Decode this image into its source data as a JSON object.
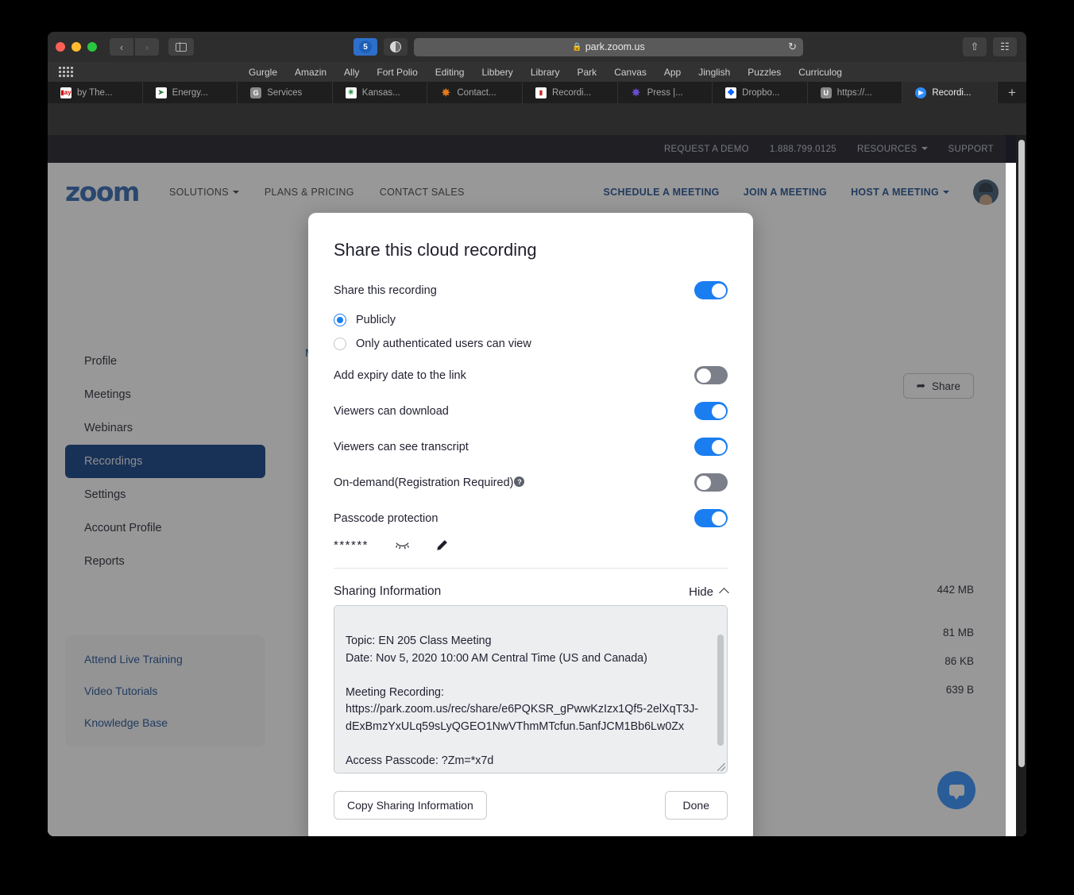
{
  "browser": {
    "address": "park.zoom.us",
    "lock_icon": "lock-icon",
    "reload_icon": "reload-icon",
    "extension_badge": "5",
    "favorites": [
      "Gurgle",
      "Amazin",
      "Ally",
      "Fort Polio",
      "Editing",
      "Libbery",
      "Library",
      "Park",
      "Canvas",
      "App",
      "Jinglish",
      "Puzzles",
      "Curriculog"
    ],
    "tabs": [
      {
        "title": "by The...",
        "favicon": "book-icon",
        "active": false
      },
      {
        "title": "Energy...",
        "favicon": "energy-icon",
        "active": false
      },
      {
        "title": "Services",
        "favicon": "g-icon",
        "active": false
      },
      {
        "title": "Kansas...",
        "favicon": "kansas-icon",
        "active": false
      },
      {
        "title": "Contact...",
        "favicon": "firefox-icon",
        "active": false
      },
      {
        "title": "Recordi...",
        "favicon": "recording-icon",
        "active": false
      },
      {
        "title": "Press |...",
        "favicon": "wordpress-icon",
        "active": false
      },
      {
        "title": "Dropbo...",
        "favicon": "dropbox-icon",
        "active": false
      },
      {
        "title": "https://...",
        "favicon": "u-icon",
        "active": false
      },
      {
        "title": "Recordi...",
        "favicon": "zoom-icon",
        "active": true
      }
    ],
    "new_tab_label": "+"
  },
  "topstrip": {
    "links": [
      "REQUEST A DEMO",
      "1.888.799.0125",
      "RESOURCES",
      "SUPPORT"
    ],
    "resources_has_caret": true
  },
  "header": {
    "logo": "zoom",
    "nav": [
      "SOLUTIONS",
      "PLANS & PRICING",
      "CONTACT SALES"
    ],
    "actions": [
      "SCHEDULE A MEETING",
      "JOIN A MEETING",
      "HOST A MEETING"
    ],
    "avatar": "avatar"
  },
  "sidebar": {
    "items": [
      {
        "label": "Profile",
        "active": false
      },
      {
        "label": "Meetings",
        "active": false
      },
      {
        "label": "Webinars",
        "active": false
      },
      {
        "label": "Recordings",
        "active": true
      },
      {
        "label": "Settings",
        "active": false
      },
      {
        "label": "Account Profile",
        "active": false
      },
      {
        "label": "Reports",
        "active": false
      }
    ],
    "help_links": [
      "Attend Live Training",
      "Video Tutorials",
      "Knowledge Base"
    ]
  },
  "content": {
    "partial_link": "M",
    "share_button": "Share",
    "file_sizes": [
      "442 MB",
      "81 MB",
      "86 KB",
      "639 B"
    ]
  },
  "modal": {
    "title": "Share this cloud recording",
    "share_recording": {
      "label": "Share this recording",
      "state": "on"
    },
    "radios": [
      {
        "label": "Publicly",
        "selected": true
      },
      {
        "label": "Only authenticated users can view",
        "selected": false
      }
    ],
    "toggles": [
      {
        "label": "Add expiry date to the link",
        "state": "off"
      },
      {
        "label": "Viewers can download",
        "state": "on"
      },
      {
        "label": "Viewers can see transcript",
        "state": "on"
      },
      {
        "label": "On-demand(Registration Required)",
        "state": "off",
        "help": true
      },
      {
        "label": "Passcode protection",
        "state": "on"
      }
    ],
    "passcode": {
      "masked": "******",
      "show_icon": "eye-closed-icon",
      "edit_icon": "pencil-icon"
    },
    "sharing_info": {
      "title": "Sharing Information",
      "toggle_label": "Hide",
      "toggle_icon": "chevron-up-icon",
      "text": "Topic: EN 205 Class Meeting\nDate: Nov 5, 2020 10:00 AM Central Time (US and Canada)\n\nMeeting Recording:\nhttps://park.zoom.us/rec/share/e6PQKSR_gPwwKzIzx1Qf5-2elXqT3J-dExBmzYxULq59sLyQGEO1NwVThmMTcfun.5anfJCM1Bb6Lw0Zx\n\nAccess Passcode: ?Zm=*x7d"
    },
    "buttons": {
      "copy": "Copy Sharing Information",
      "done": "Done"
    }
  },
  "colors": {
    "accent_blue": "#1a7ef0",
    "zoom_blue": "#2d65b0",
    "sidebar_active": "#0b3b81"
  }
}
